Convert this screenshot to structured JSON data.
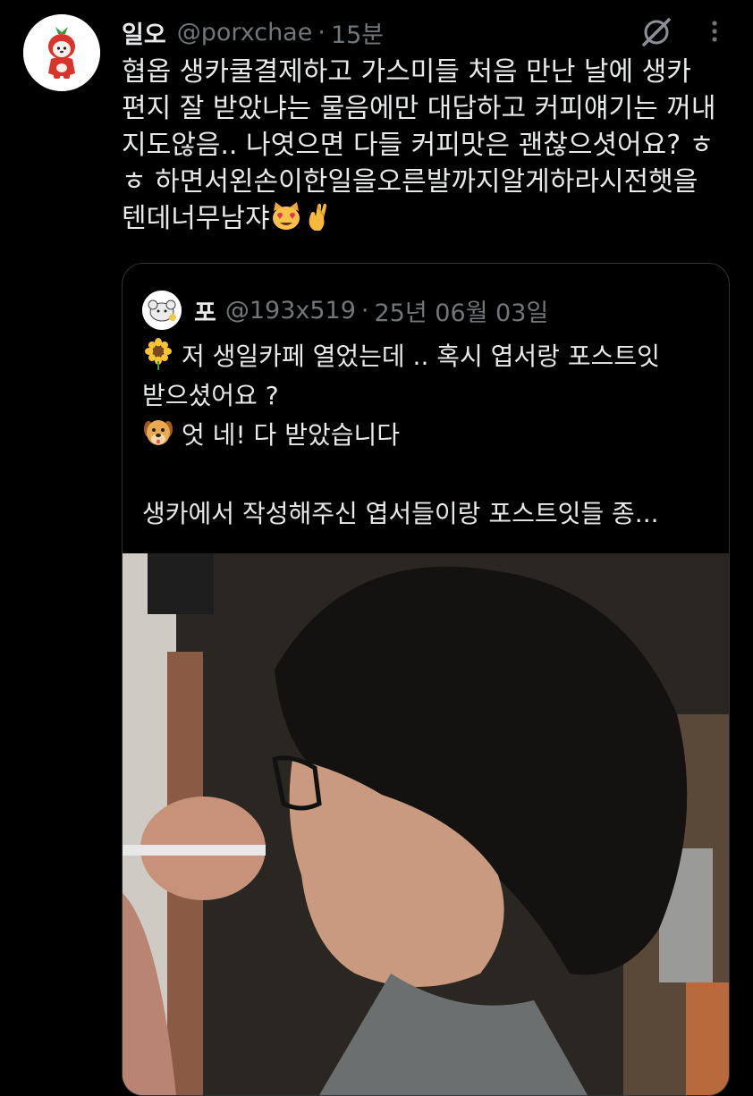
{
  "tweet": {
    "display_name": "일오",
    "handle": "@porxchae",
    "separator": "·",
    "time": "15분",
    "lines": [
      "협옵 생카쿨결제하고 가스미들 처음 만난 날에 생카",
      "편지 잘 받았냐는 물음에만 대답하고 커피얘기는 꺼내",
      "지도않음.. 나엿으면  다들 커피맛은 괜찮으셧어요? ㅎ",
      "ㅎ  하면서왼손이한일을오른발까지알게하라시전햇을",
      "텐데너무남쟈"
    ],
    "emojis": [
      "heart-eyes-cat-icon",
      "crossed-fingers-icon"
    ]
  },
  "quote": {
    "display_name": "포",
    "handle": "@193x519",
    "separator": "·",
    "date": "25년 06월 03일",
    "line1": "저 생일카페 열었는데 .. 혹시 엽서랑 포스트잇",
    "line2": "받으셨어요 ?",
    "line3": "엇 네! 다 받았습니다",
    "line4": "생카에서 작성해주신 엽서들이랑 포스트잇들 종...",
    "line1_emoji": "sunflower-icon",
    "line3_emoji": "dog-face-icon"
  },
  "colors": {
    "background": "#000000",
    "text": "#e7e9ea",
    "muted": "#71767b",
    "border": "#2f3336",
    "avatar_red": "#d9342b"
  }
}
